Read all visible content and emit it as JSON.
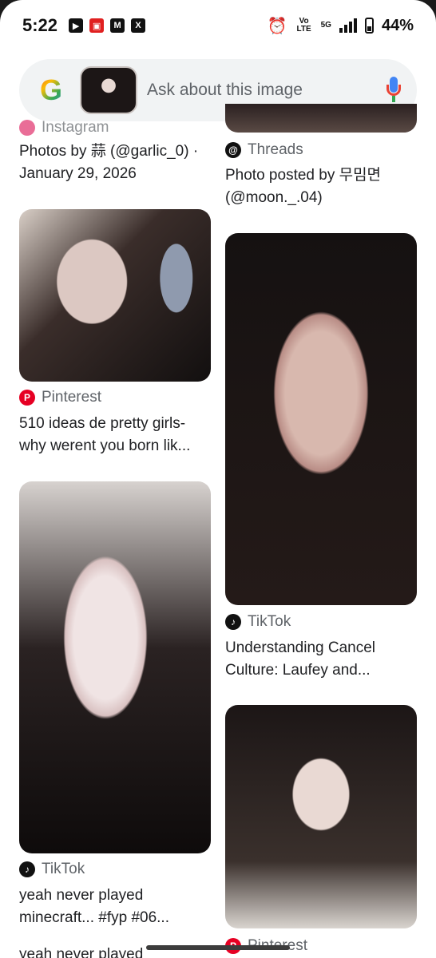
{
  "status_bar": {
    "time": "5:22",
    "notification_icons": [
      "youtube-icon",
      "shop-icon",
      "gmail-icon",
      "x-icon"
    ],
    "network_label": "5G",
    "volte_label": "Vo LTE",
    "battery": "44%"
  },
  "search": {
    "placeholder": "Ask about this image"
  },
  "results": {
    "left": [
      {
        "source": "Instagram",
        "title": "Photos by 蒜 (@garlic_0) · January 29, 2026"
      },
      {
        "source": "Pinterest",
        "title": "510 ideas de pretty girls- why werent you born lik..."
      },
      {
        "source": "TikTok",
        "title": "yeah never played minecraft... #fyp #06..."
      },
      {
        "title": "yeah never played"
      }
    ],
    "right": [
      {
        "source": "Threads",
        "title": "Photo posted by 무밈면 (@moon._.04)"
      },
      {
        "source": "TikTok",
        "title": "Understanding Cancel Culture: Laufey and..."
      },
      {
        "source": "Pinterest"
      }
    ]
  },
  "colors": {
    "pinterest": "#e60023",
    "tiktok": "#111111",
    "search_bg": "#f1f3f4"
  }
}
